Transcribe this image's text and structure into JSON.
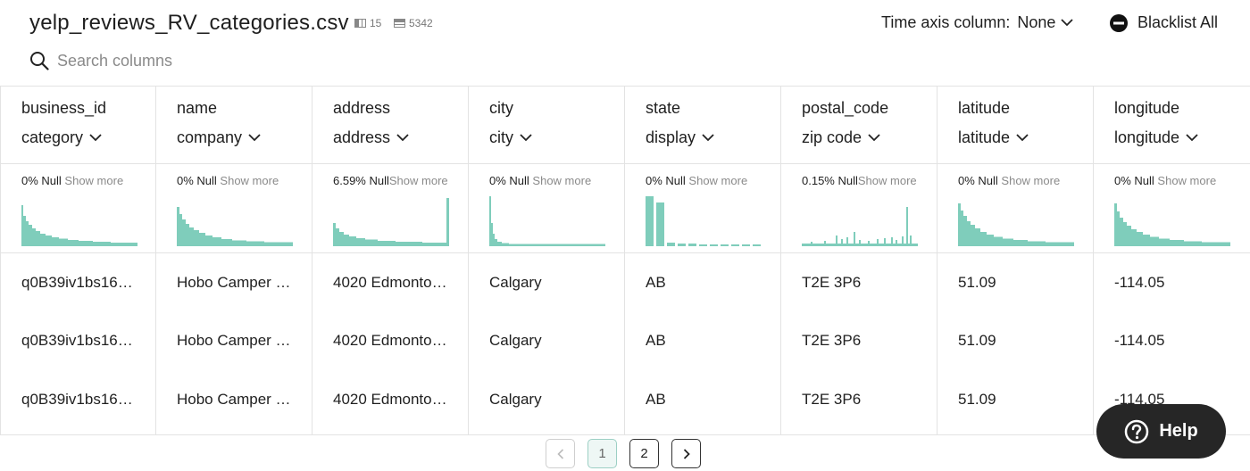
{
  "header": {
    "file_name": "yelp_reviews_RV_categories.csv",
    "column_count": "15",
    "row_count": "5342",
    "time_axis_label": "Time axis column:",
    "time_axis_value": "None",
    "blacklist_label": "Blacklist All"
  },
  "search": {
    "placeholder": "Search columns"
  },
  "columns": [
    {
      "name": "business_id",
      "type": "category",
      "null_pct": "0% Null",
      "show_more": "Show more",
      "cells": [
        "q0B39iv1bs16…",
        "q0B39iv1bs16…",
        "q0B39iv1bs16…"
      ]
    },
    {
      "name": "name",
      "type": "company",
      "null_pct": "0% Null",
      "show_more": "Show more",
      "cells": [
        "Hobo Camper …",
        "Hobo Camper …",
        "Hobo Camper …"
      ]
    },
    {
      "name": "address",
      "type": "address",
      "null_pct": "6.59% Null",
      "show_more": "Show more",
      "cells": [
        "4020 Edmonto…",
        "4020 Edmonto…",
        "4020 Edmonto…"
      ]
    },
    {
      "name": "city",
      "type": "city",
      "null_pct": "0% Null",
      "show_more": "Show more",
      "cells": [
        "Calgary",
        "Calgary",
        "Calgary"
      ]
    },
    {
      "name": "state",
      "type": "display",
      "null_pct": "0% Null",
      "show_more": "Show more",
      "cells": [
        "AB",
        "AB",
        "AB"
      ]
    },
    {
      "name": "postal_code",
      "type": "zip code",
      "null_pct": "0.15% Null",
      "show_more": "Show more",
      "cells": [
        "T2E 3P6",
        "T2E 3P6",
        "T2E 3P6"
      ]
    },
    {
      "name": "latitude",
      "type": "latitude",
      "null_pct": "0% Null",
      "show_more": "Show more",
      "cells": [
        "51.09",
        "51.09",
        "51.09"
      ]
    },
    {
      "name": "longitude",
      "type": "longitude",
      "null_pct": "0% Null",
      "show_more": "Show more",
      "cells": [
        "-114.05",
        "-114.05",
        "-114.05"
      ]
    }
  ],
  "pagination": {
    "prev": "‹",
    "pages": [
      "1",
      "2"
    ],
    "next": "›",
    "current": "1"
  },
  "help": {
    "label": "Help"
  },
  "colors": {
    "accent": "#7fcdbb",
    "text": "#1f1f1f",
    "border": "#e3e3e3",
    "help_bg": "#262626"
  },
  "icons": {
    "columns": "columns-icon",
    "rows": "rows-icon",
    "dropdown": "chevron-down-icon",
    "blacklist": "minus-circle-icon",
    "search": "search-icon",
    "help": "question-circle-icon"
  }
}
